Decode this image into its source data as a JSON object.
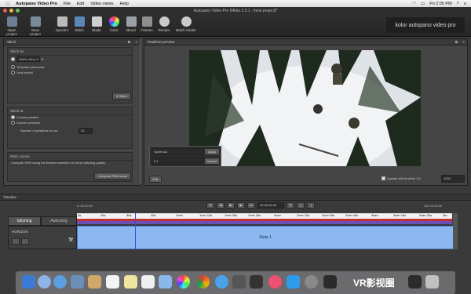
{
  "menubar": {
    "app_name": "Autopano Video Pro",
    "items": [
      "File",
      "Edit",
      "Video views",
      "Help"
    ],
    "clock": "Fri 2:05 PM"
  },
  "window": {
    "title": "Autopano Video Pro 64bits 2.3.1 - [new project]*"
  },
  "toolbar": {
    "buttons": [
      "Open project",
      "Save project",
      "Synchro",
      "Stitch",
      "Blade",
      "Color",
      "Blend",
      "Frames",
      "Render",
      "Batch render"
    ],
    "brand": "kolor autopano video pro"
  },
  "stitch_panel": {
    "header": "Stitch",
    "stitch_as_title": "Stitch as",
    "stitch_as_options": [
      "GoPro Hero 3",
      "Template panorama",
      "Lens model"
    ],
    "stitch_button": "Stitch",
    "stitch_at_title": "Stitch at",
    "stitch_at_options": [
      "Current position",
      "Current selection"
    ],
    "positions_label": "Number of positions to use",
    "positions_value": "10",
    "rms_title": "RMS curves",
    "rms_desc": "Compute RMS along the timeline selection to check stitching quality.",
    "rms_button": "Compute RMS curve"
  },
  "preview": {
    "header": "Realtime preview",
    "projection": "Spherical",
    "ratio": "2:1",
    "apply": "Apply",
    "cancel": "Cancel",
    "edit_button": "Edit",
    "update_label": "Update with timeline",
    "update_value": "1/4",
    "resolution": "1024"
  },
  "timeline": {
    "header": "Timeline",
    "in_label": "In 00:00:00",
    "out_label": "Out 00:00:00",
    "current_time": "00:06:06.08",
    "tabs": [
      "Stitching",
      "Authoring"
    ],
    "track_label": "HORIZON",
    "ticks": [
      "0s",
      "15s",
      "30s",
      "45s",
      "1min",
      "1min 15s",
      "1min 30s",
      "1min 45s",
      "2min",
      "2min 15s",
      "2min 30s",
      "2min 45s",
      "3min",
      "3min 15s",
      "3min 30s",
      "3m"
    ],
    "state_label": "State 1"
  },
  "watermark": "VR影视圈"
}
